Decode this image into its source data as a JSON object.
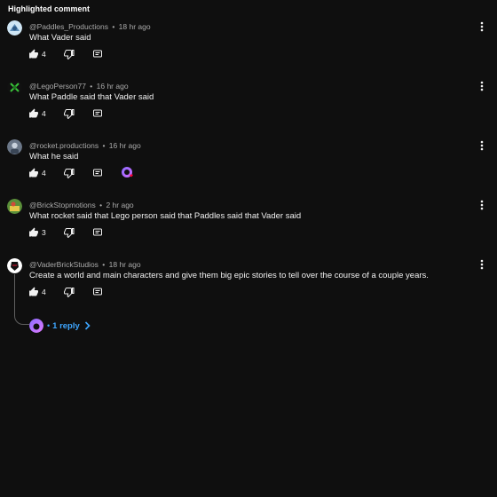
{
  "header": {
    "label": "Highlighted comment"
  },
  "comments": [
    {
      "author": "@Paddles_Productions",
      "time": "18 hr ago",
      "text": "What Vader said",
      "likes": "4"
    },
    {
      "author": "@LegoPerson77",
      "time": "16 hr ago",
      "text": "What Paddle said that Vader said",
      "likes": "4"
    },
    {
      "author": "@rocket.productions",
      "time": "16 hr ago",
      "text": "What he said",
      "likes": "4",
      "creator_heart": true
    },
    {
      "author": "@BrickStopmotions",
      "time": "2 hr ago",
      "text": "What rocket said that Lego person said that Paddles said that Vader said",
      "likes": "3"
    },
    {
      "author": "@VaderBrickStudios",
      "time": "18 hr ago",
      "text": "Create a world and main characters and give them big epic stories to tell over the course of a couple years.",
      "likes": "4"
    }
  ],
  "replies": {
    "dot": "•",
    "label": "1 reply"
  },
  "icons": {
    "like": "thumbs-up-icon",
    "dislike": "thumbs-down-icon",
    "reply": "reply-icon",
    "more": "more-vert-icon",
    "chevron": "chevron-right-icon",
    "heart": "creator-heart-icon"
  },
  "colors": {
    "background": "#0f0f0f",
    "text": "#f1f1f1",
    "meta": "#aaaaaa",
    "link": "#3ea6ff",
    "heart": "#ff0033"
  }
}
